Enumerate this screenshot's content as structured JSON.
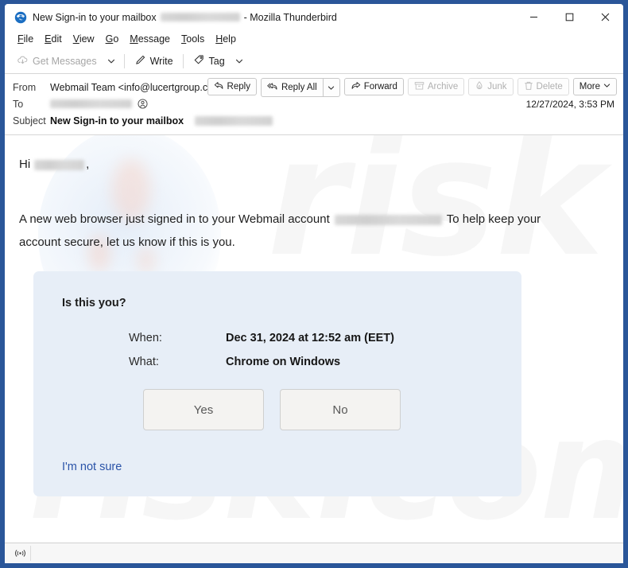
{
  "window": {
    "title": "New Sign-in to your mailbox",
    "title_redacted": true,
    "app_name": "- Mozilla Thunderbird",
    "app_icon": "thunderbird-icon",
    "controls": {
      "minimize": "minimize-icon",
      "maximize": "maximize-icon",
      "close": "close-icon"
    }
  },
  "menubar": {
    "items": [
      {
        "label": "File",
        "accesskey": "F"
      },
      {
        "label": "Edit",
        "accesskey": "E"
      },
      {
        "label": "View",
        "accesskey": "V"
      },
      {
        "label": "Go",
        "accesskey": "G"
      },
      {
        "label": "Message",
        "accesskey": "M"
      },
      {
        "label": "Tools",
        "accesskey": "T"
      },
      {
        "label": "Help",
        "accesskey": "H"
      }
    ]
  },
  "toolbar": {
    "get_messages": "Get Messages",
    "get_messages_disabled": true,
    "write": "Write",
    "tag": "Tag"
  },
  "message_header": {
    "from_label": "From",
    "from_value": "Webmail Team <info@lucertgroup.com>",
    "to_label": "To",
    "to_value_redacted": true,
    "subject_label": "Subject",
    "subject_value": "New Sign-in to your mailbox",
    "subject_redacted": true,
    "date": "12/27/2024, 3:53 PM"
  },
  "actions": [
    {
      "label": "Reply",
      "icon": "reply-icon",
      "disabled": false
    },
    {
      "label": "Reply All",
      "icon": "reply-all-icon",
      "disabled": false,
      "has_caret": true
    },
    {
      "label": "Forward",
      "icon": "forward-icon",
      "disabled": false
    },
    {
      "label": "Archive",
      "icon": "archive-icon",
      "disabled": true
    },
    {
      "label": "Junk",
      "icon": "junk-icon",
      "disabled": true
    },
    {
      "label": "Delete",
      "icon": "trash-icon",
      "disabled": true
    },
    {
      "label": "More",
      "icon": "chevron-down-icon",
      "disabled": false,
      "has_caret": true
    }
  ],
  "body": {
    "greeting_prefix": "Hi",
    "greeting_name_redacted": true,
    "greeting_suffix": ",",
    "paragraph_part1": "A new web browser just signed in to your Webmail account",
    "paragraph_account_redacted": true,
    "paragraph_part2": "To help keep your",
    "paragraph_line2": "account secure, let us know if this is you."
  },
  "info_panel": {
    "title": "Is this you?",
    "rows": [
      {
        "key": "When:",
        "value": "Dec 31, 2024 at 12:52 am (EET)"
      },
      {
        "key": "What:",
        "value": "Chrome on Windows"
      }
    ],
    "buttons": [
      {
        "label": "Yes",
        "name": "yes-button"
      },
      {
        "label": "No",
        "name": "no-button"
      }
    ],
    "link": "I'm not sure",
    "background_color": "#e7eef7",
    "link_color": "#2a53a8"
  },
  "watermark": {
    "line1": "risk",
    "line2": "risk.com"
  },
  "statusbar": {
    "icon": "broadcast-icon",
    "text": ""
  }
}
